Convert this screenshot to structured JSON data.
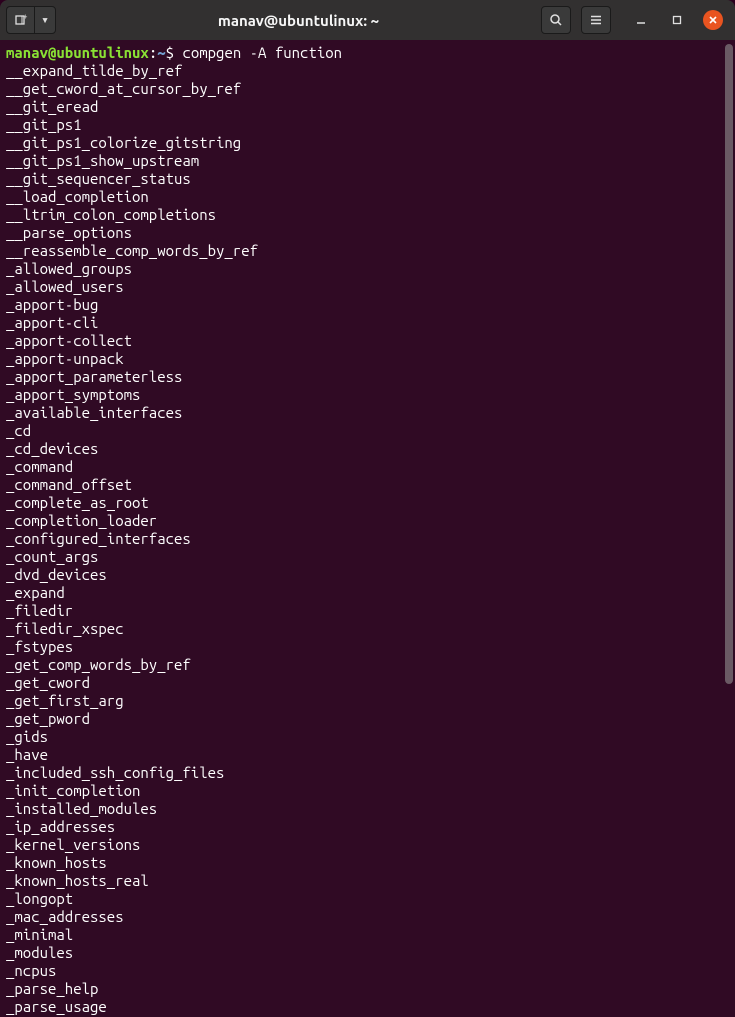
{
  "titlebar": {
    "title": "manav@ubuntulinux: ~"
  },
  "prompt": {
    "userhost": "manav@ubuntulinux",
    "sep": ":",
    "path": "~",
    "symbol": "$",
    "command": "compgen -A function"
  },
  "output_lines": [
    "__expand_tilde_by_ref",
    "__get_cword_at_cursor_by_ref",
    "__git_eread",
    "__git_ps1",
    "__git_ps1_colorize_gitstring",
    "__git_ps1_show_upstream",
    "__git_sequencer_status",
    "__load_completion",
    "__ltrim_colon_completions",
    "__parse_options",
    "__reassemble_comp_words_by_ref",
    "_allowed_groups",
    "_allowed_users",
    "_apport-bug",
    "_apport-cli",
    "_apport-collect",
    "_apport-unpack",
    "_apport_parameterless",
    "_apport_symptoms",
    "_available_interfaces",
    "_cd",
    "_cd_devices",
    "_command",
    "_command_offset",
    "_complete_as_root",
    "_completion_loader",
    "_configured_interfaces",
    "_count_args",
    "_dvd_devices",
    "_expand",
    "_filedir",
    "_filedir_xspec",
    "_fstypes",
    "_get_comp_words_by_ref",
    "_get_cword",
    "_get_first_arg",
    "_get_pword",
    "_gids",
    "_have",
    "_included_ssh_config_files",
    "_init_completion",
    "_installed_modules",
    "_ip_addresses",
    "_kernel_versions",
    "_known_hosts",
    "_known_hosts_real",
    "_longopt",
    "_mac_addresses",
    "_minimal",
    "_modules",
    "_ncpus",
    "_parse_help",
    "_parse_usage"
  ]
}
